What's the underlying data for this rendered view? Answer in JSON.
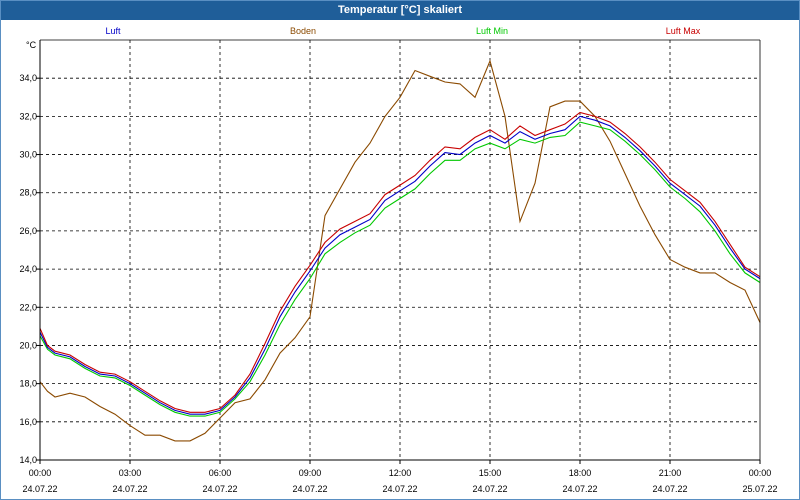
{
  "window": {
    "title": "Temperatur [°C] skaliert"
  },
  "chart_data": {
    "type": "line",
    "title": "Temperatur [°C] skaliert",
    "yunit": "°C",
    "ylim": [
      14,
      36
    ],
    "yticks": [
      14,
      16,
      18,
      20,
      22,
      24,
      26,
      28,
      30,
      32,
      34
    ],
    "ytick_labels": [
      "14,0",
      "16,0",
      "18,0",
      "20,0",
      "22,0",
      "24,0",
      "26,0",
      "28,0",
      "30,0",
      "32,0",
      "34,0"
    ],
    "xlim_hours": [
      0,
      24
    ],
    "xticks": [
      {
        "h": 0,
        "time": "00:00",
        "date": "24.07.22"
      },
      {
        "h": 3,
        "time": "03:00",
        "date": "24.07.22"
      },
      {
        "h": 6,
        "time": "06:00",
        "date": "24.07.22"
      },
      {
        "h": 9,
        "time": "09:00",
        "date": "24.07.22"
      },
      {
        "h": 12,
        "time": "12:00",
        "date": "24.07.22"
      },
      {
        "h": 15,
        "time": "15:00",
        "date": "24.07.22"
      },
      {
        "h": 18,
        "time": "18:00",
        "date": "24.07.22"
      },
      {
        "h": 21,
        "time": "21:00",
        "date": "24.07.22"
      },
      {
        "h": 24,
        "time": "00:00",
        "date": "25.07.22"
      }
    ],
    "grid": true,
    "series": [
      {
        "name": "Luft",
        "color": "#0000c8",
        "x": [
          0,
          0.25,
          0.5,
          1,
          1.5,
          2,
          2.5,
          3,
          3.5,
          4,
          4.5,
          5,
          5.5,
          6,
          6.5,
          7,
          7.5,
          8,
          8.5,
          9,
          9.5,
          10,
          10.5,
          11,
          11.5,
          12,
          12.5,
          13,
          13.5,
          14,
          14.5,
          15,
          15.5,
          16,
          16.5,
          17,
          17.5,
          18,
          18.5,
          19,
          19.5,
          20,
          20.5,
          21,
          21.5,
          22,
          22.5,
          23,
          23.5,
          24
        ],
        "y": [
          20.7,
          19.9,
          19.6,
          19.4,
          18.9,
          18.5,
          18.4,
          18.0,
          17.5,
          17.0,
          16.6,
          16.4,
          16.4,
          16.6,
          17.3,
          18.3,
          19.8,
          21.5,
          22.8,
          23.9,
          25.1,
          25.8,
          26.2,
          26.6,
          27.6,
          28.1,
          28.6,
          29.4,
          30.1,
          30.0,
          30.6,
          31.0,
          30.6,
          31.2,
          30.8,
          31.1,
          31.3,
          32.0,
          31.8,
          31.5,
          30.9,
          30.2,
          29.4,
          28.5,
          27.9,
          27.3,
          26.3,
          25.1,
          24.0,
          23.5
        ]
      },
      {
        "name": "Boden",
        "color": "#8b4a00",
        "x": [
          0,
          0.25,
          0.5,
          1,
          1.5,
          2,
          2.5,
          3,
          3.5,
          4,
          4.5,
          5,
          5.5,
          6,
          6.5,
          7,
          7.5,
          8,
          8.5,
          9,
          9.5,
          10,
          10.5,
          11,
          11.5,
          12,
          12.5,
          13,
          13.5,
          14,
          14.5,
          15,
          15.5,
          16,
          16.5,
          17,
          17.5,
          18,
          18.5,
          19,
          19.5,
          20,
          20.5,
          21,
          21.5,
          22,
          22.5,
          23,
          23.5,
          24
        ],
        "y": [
          18.1,
          17.6,
          17.3,
          17.5,
          17.3,
          16.8,
          16.4,
          15.8,
          15.3,
          15.3,
          15.0,
          15.0,
          15.4,
          16.2,
          17.0,
          17.2,
          18.2,
          19.6,
          20.4,
          21.5,
          26.8,
          28.2,
          29.6,
          30.6,
          32.0,
          33.0,
          34.4,
          34.1,
          33.8,
          33.7,
          33.0,
          34.9,
          32.0,
          26.5,
          28.5,
          32.5,
          32.8,
          32.8,
          32.0,
          30.7,
          29.0,
          27.3,
          25.8,
          24.5,
          24.1,
          23.8,
          23.8,
          23.3,
          22.9,
          21.2
        ]
      },
      {
        "name": "Luft Min",
        "color": "#00c800",
        "x": [
          0,
          0.25,
          0.5,
          1,
          1.5,
          2,
          2.5,
          3,
          3.5,
          4,
          4.5,
          5,
          5.5,
          6,
          6.5,
          7,
          7.5,
          8,
          8.5,
          9,
          9.5,
          10,
          10.5,
          11,
          11.5,
          12,
          12.5,
          13,
          13.5,
          14,
          14.5,
          15,
          15.5,
          16,
          16.5,
          17,
          17.5,
          18,
          18.5,
          19,
          19.5,
          20,
          20.5,
          21,
          21.5,
          22,
          22.5,
          23,
          23.5,
          24
        ],
        "y": [
          20.5,
          19.8,
          19.5,
          19.3,
          18.8,
          18.4,
          18.3,
          17.9,
          17.4,
          16.9,
          16.5,
          16.3,
          16.3,
          16.5,
          17.2,
          18.1,
          19.5,
          21.1,
          22.4,
          23.5,
          24.8,
          25.4,
          25.9,
          26.3,
          27.2,
          27.7,
          28.2,
          29.0,
          29.7,
          29.7,
          30.3,
          30.6,
          30.3,
          30.8,
          30.6,
          30.9,
          31.0,
          31.7,
          31.5,
          31.3,
          30.7,
          30.0,
          29.2,
          28.3,
          27.7,
          27.0,
          26.0,
          24.8,
          23.8,
          23.3
        ]
      },
      {
        "name": "Luft Max",
        "color": "#c80000",
        "x": [
          0,
          0.25,
          0.5,
          1,
          1.5,
          2,
          2.5,
          3,
          3.5,
          4,
          4.5,
          5,
          5.5,
          6,
          6.5,
          7,
          7.5,
          8,
          8.5,
          9,
          9.5,
          10,
          10.5,
          11,
          11.5,
          12,
          12.5,
          13,
          13.5,
          14,
          14.5,
          15,
          15.5,
          16,
          16.5,
          17,
          17.5,
          18,
          18.5,
          19,
          19.5,
          20,
          20.5,
          21,
          21.5,
          22,
          22.5,
          23,
          23.5,
          24
        ],
        "y": [
          20.9,
          20.0,
          19.7,
          19.5,
          19.0,
          18.6,
          18.5,
          18.1,
          17.6,
          17.1,
          16.7,
          16.5,
          16.5,
          16.7,
          17.4,
          18.5,
          20.1,
          21.8,
          23.1,
          24.2,
          25.4,
          26.1,
          26.5,
          26.9,
          27.9,
          28.4,
          28.9,
          29.7,
          30.4,
          30.3,
          30.9,
          31.3,
          30.8,
          31.5,
          31.0,
          31.3,
          31.6,
          32.2,
          32.0,
          31.7,
          31.1,
          30.4,
          29.6,
          28.7,
          28.1,
          27.5,
          26.5,
          25.3,
          24.1,
          23.6
        ]
      }
    ]
  }
}
